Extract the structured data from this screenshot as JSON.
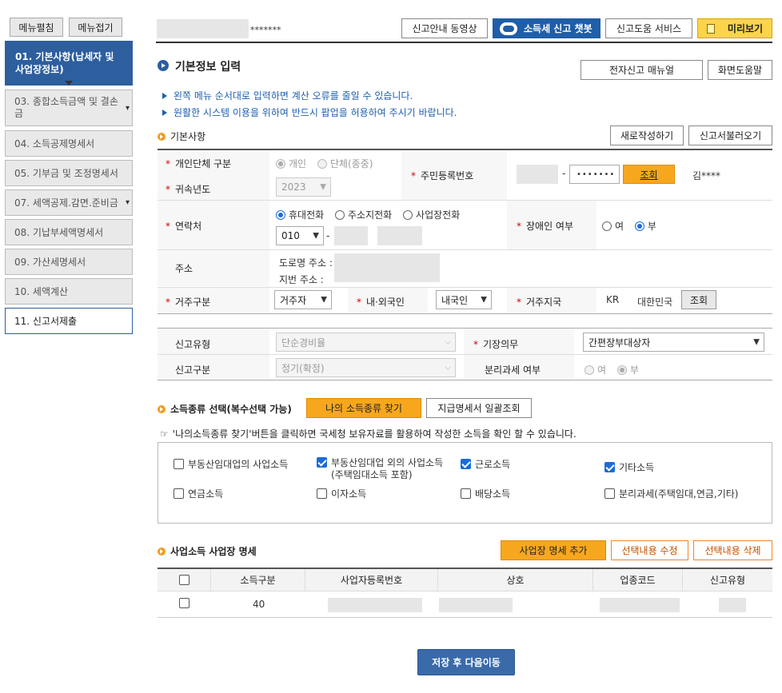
{
  "sidebar": {
    "expand_label": "메뉴펼침",
    "collapse_label": "메뉴접기",
    "items": [
      {
        "label": "01. 기본사항(납세자 및 사업장정보)"
      },
      {
        "label": "03. 종합소득금액 및 결손금"
      },
      {
        "label": "04. 소득공제명세서"
      },
      {
        "label": "05. 기부금 및 조정명세서"
      },
      {
        "label": "07. 세액공제.감면.준비금"
      },
      {
        "label": "08. 기납부세액명세서"
      },
      {
        "label": "09. 가산세명세서"
      },
      {
        "label": "10. 세액계산"
      },
      {
        "label": "11. 신고서제출"
      }
    ]
  },
  "header": {
    "masked_name": "*******",
    "guide_video": "신고안내 동영상",
    "chatbot": "소득세 신고 챗봇",
    "help_service": "신고도움 서비스",
    "preview": "미리보기"
  },
  "page": {
    "title": "기본정보 입력",
    "manual_btn": "전자신고 매뉴얼",
    "help_btn": "화면도움말",
    "info1": "왼쪽 메뉴 순서대로 입력하면 계산 오류를 줄일 수 있습니다.",
    "info2": "원활한 시스템 이용을 위하여 반드시 팝업을 허용하여 주시기 바랍니다."
  },
  "basic": {
    "section": "기본사항",
    "new_btn": "새로작성하기",
    "load_btn": "신고서불러오기",
    "person_type_label": "개인단체 구분",
    "person_opt1": "개인",
    "person_opt2": "단체(종중)",
    "year_label": "귀속년도",
    "year_value": "2023",
    "rrn_label": "주민등록번호",
    "rrn_dash": "-",
    "rrn_back": "•••••••",
    "lookup_btn": "조회",
    "name_masked": "김****",
    "contact_label": "연락처",
    "contact_opt1": "휴대전화",
    "contact_opt2": "주소지전화",
    "contact_opt3": "사업장전화",
    "phone_prefix": "010",
    "phone_dash": "-",
    "disabled_label": "장애인 여부",
    "disabled_yes": "여",
    "disabled_no": "부",
    "address_label": "주소",
    "road_address": "도로명 주소 :",
    "lot_address": "지번 주소 :",
    "residence_label": "거주구분",
    "residence_value": "거주자",
    "nationality_label": "내·외국인",
    "nationality_value": "내국인",
    "region_label": "거주지국",
    "region_code": "KR",
    "region_name": "대한민국",
    "region_btn": "조회"
  },
  "report": {
    "type_label": "신고유형",
    "type_value": "단순경비율",
    "bookkeeping_label": "기장의무",
    "bookkeeping_value": "간편장부대상자",
    "category_label": "신고구분",
    "category_value": "정기(확정)",
    "separate_label": "분리과세 여부",
    "separate_yes": "여",
    "separate_no": "부"
  },
  "income": {
    "section": "소득종류 선택(복수선택 가능)",
    "find_btn": "나의 소득종류 찾기",
    "statement_btn": "지급명세서 일괄조회",
    "hint_icon": "☞",
    "hint": "'나의소득종류 찾기'버튼을 클릭하면 국세청 보유자료를 활용하여 작성한 소득을 확인 할 수 있습니다.",
    "types": [
      {
        "label": "부동산임대업의 사업소득",
        "checked": false
      },
      {
        "label": "부동산임대업 외의 사업소득",
        "sub": "(주택임대소득 포함)",
        "checked": true
      },
      {
        "label": "근로소득",
        "checked": true
      },
      {
        "label": "기타소득",
        "checked": true
      },
      {
        "label": "연금소득",
        "checked": false
      },
      {
        "label": "이자소득",
        "checked": false
      },
      {
        "label": "배당소득",
        "checked": false
      },
      {
        "label": "분리과세(주택임대,연금,기타)",
        "checked": false
      }
    ]
  },
  "business": {
    "section": "사업소득 사업장 명세",
    "add_btn": "사업장 명세 추가",
    "edit_btn": "선택내용 수정",
    "delete_btn": "선택내용 삭제",
    "columns": [
      "소득구분",
      "사업자등록번호",
      "상호",
      "업종코드",
      "신고유형"
    ],
    "rows": [
      {
        "income_type": "40"
      }
    ]
  },
  "footer": {
    "save_next": "저장 후 다음이동"
  },
  "colors": {
    "primary": "#2d5e9e",
    "accent": "#f7a71e",
    "required": "#d40000",
    "info": "#1d5fb0"
  }
}
